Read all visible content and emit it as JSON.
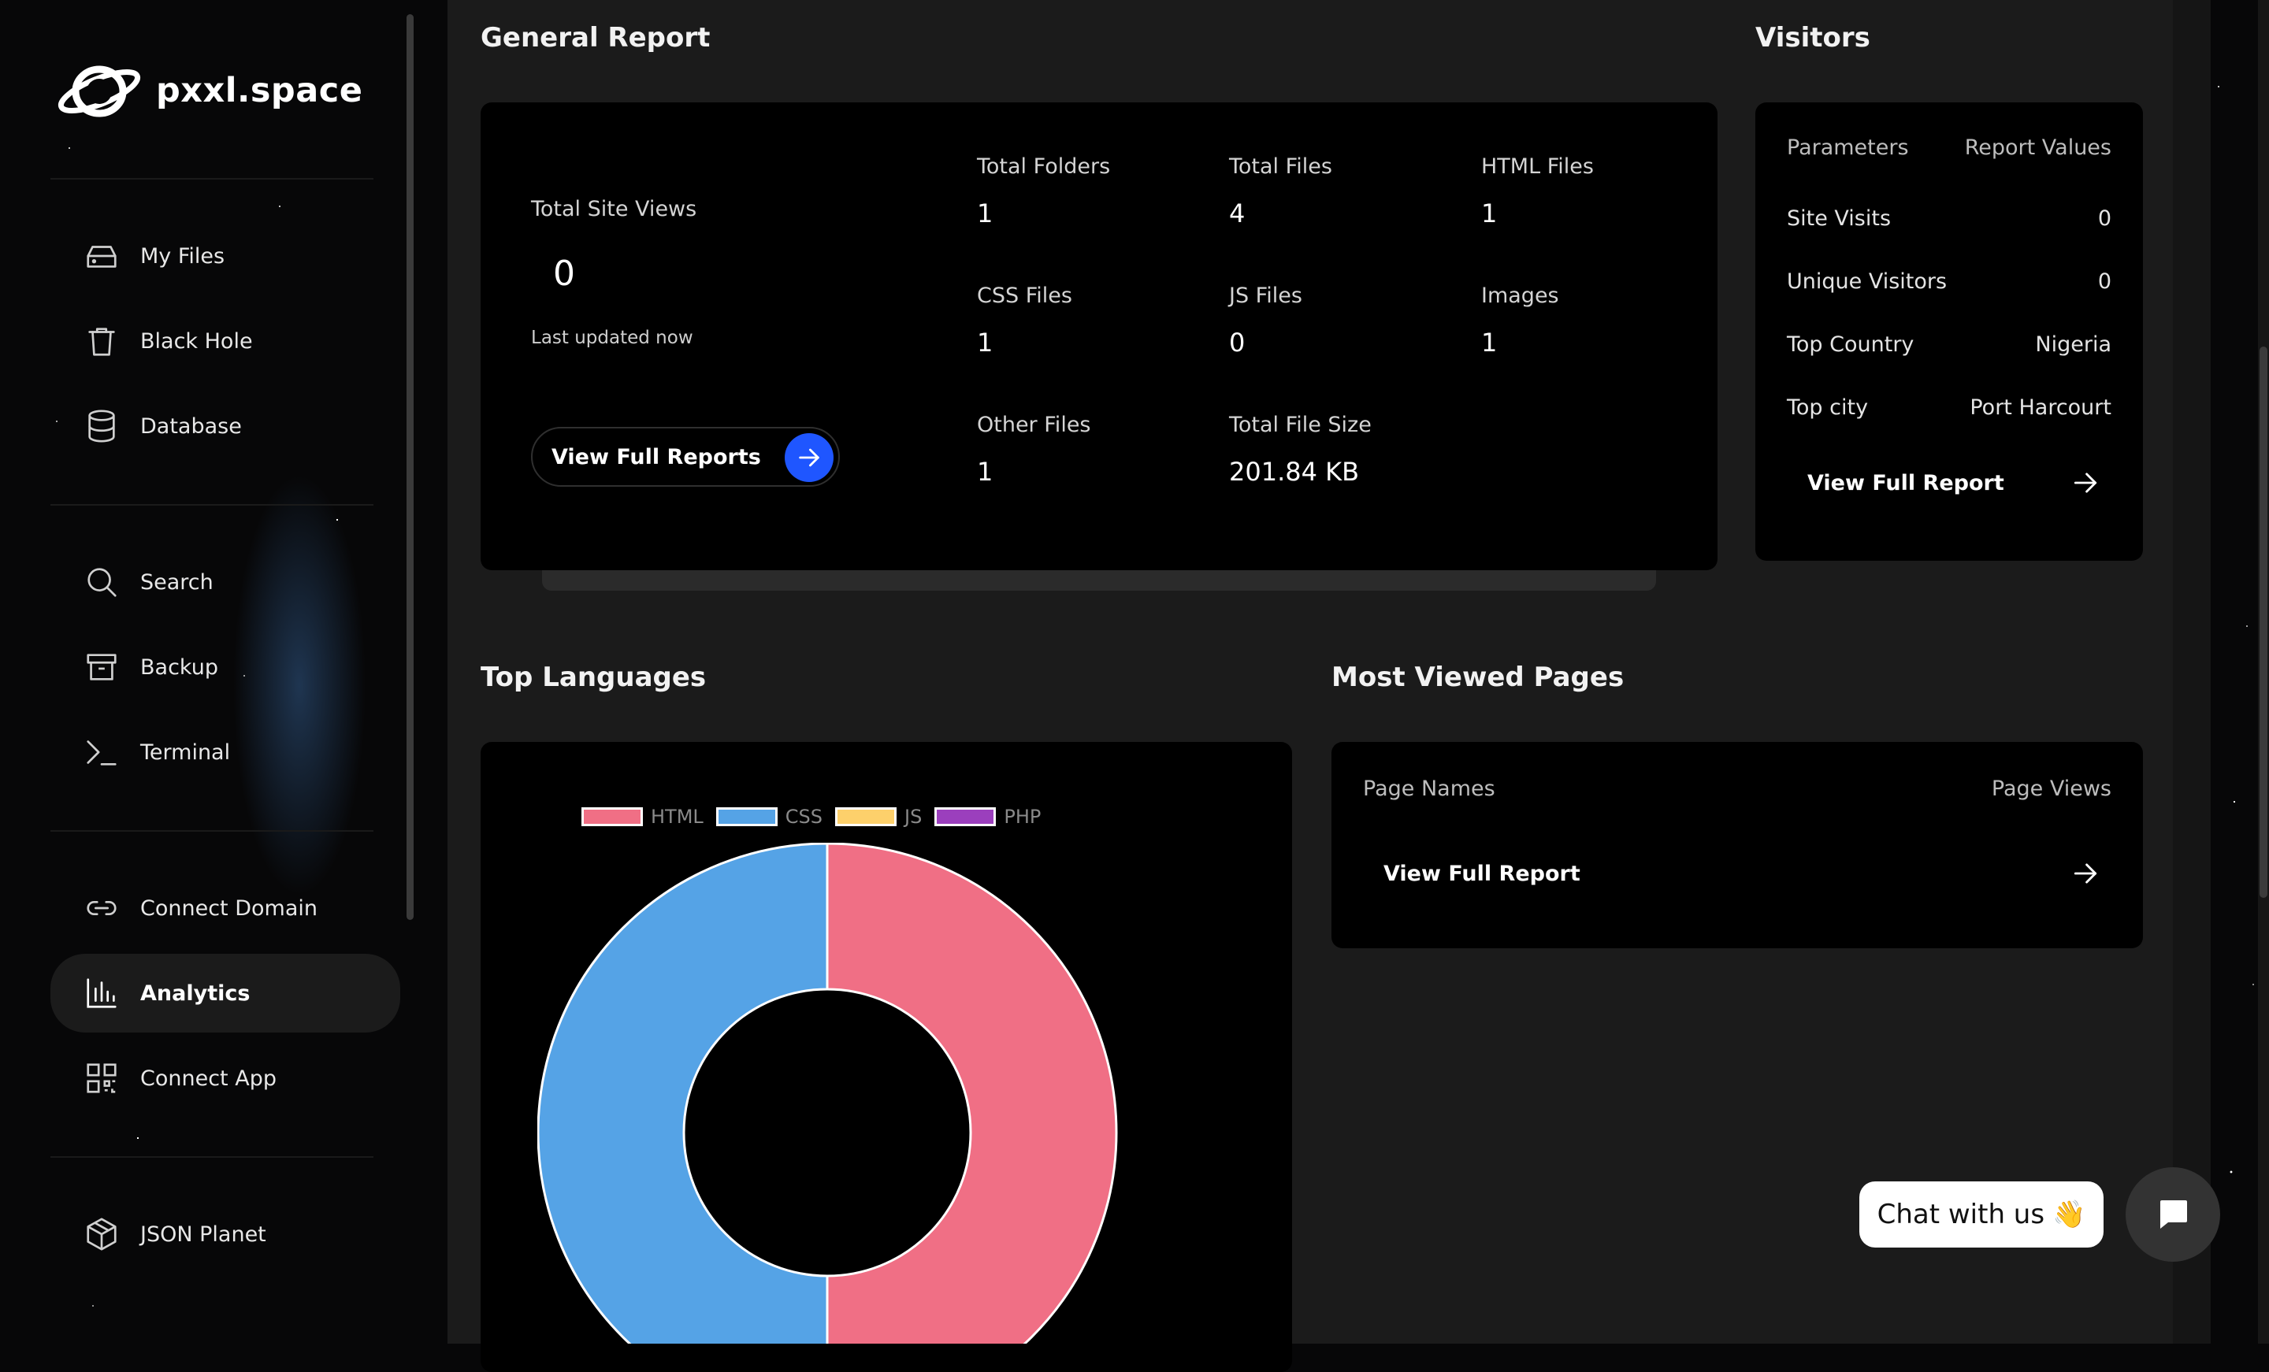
{
  "brand": {
    "name": "pxxl.space"
  },
  "sidebar": {
    "groups": [
      [
        {
          "label": "My Files",
          "icon": "drive-icon"
        },
        {
          "label": "Black Hole",
          "icon": "trash-icon"
        },
        {
          "label": "Database",
          "icon": "database-icon"
        }
      ],
      [
        {
          "label": "Search",
          "icon": "search-icon"
        },
        {
          "label": "Backup",
          "icon": "archive-icon"
        },
        {
          "label": "Terminal",
          "icon": "terminal-icon"
        }
      ],
      [
        {
          "label": "Connect Domain",
          "icon": "link-icon"
        },
        {
          "label": "Analytics",
          "icon": "bar-chart-icon",
          "active": true
        },
        {
          "label": "Connect App",
          "icon": "qr-code-icon"
        }
      ],
      [
        {
          "label": "JSON Planet",
          "icon": "cube-icon"
        }
      ]
    ]
  },
  "general_report": {
    "title": "General Report",
    "views_label": "Total Site Views",
    "views_value": "0",
    "updated": "Last updated now",
    "button_label": "View Full Reports",
    "stats": [
      {
        "label": "Total Folders",
        "value": "1"
      },
      {
        "label": "Total Files",
        "value": "4"
      },
      {
        "label": "HTML Files",
        "value": "1"
      },
      {
        "label": "CSS Files",
        "value": "1"
      },
      {
        "label": "JS Files",
        "value": "0"
      },
      {
        "label": "Images",
        "value": "1"
      },
      {
        "label": "Other Files",
        "value": "1"
      },
      {
        "label": "Total File Size",
        "value": "201.84 KB"
      }
    ]
  },
  "visitors": {
    "title": "Visitors",
    "header_left": "Parameters",
    "header_right": "Report Values",
    "rows": [
      {
        "label": "Site Visits",
        "value": "0"
      },
      {
        "label": "Unique Visitors",
        "value": "0"
      },
      {
        "label": "Top Country",
        "value": "Nigeria"
      },
      {
        "label": "Top city",
        "value": "Port Harcourt"
      }
    ],
    "link_label": "View Full Report"
  },
  "top_languages": {
    "title": "Top Languages"
  },
  "most_viewed": {
    "title": "Most Viewed Pages",
    "header_left": "Page Names",
    "header_right": "Page Views",
    "link_label": "View Full Report"
  },
  "chart_data": {
    "type": "pie",
    "variant": "doughnut",
    "categories": [
      "HTML",
      "CSS",
      "JS",
      "PHP"
    ],
    "values": [
      1,
      1,
      0,
      0
    ],
    "colors": [
      "#f06f85",
      "#55a3e6",
      "#fdd06b",
      "#9b3fbd"
    ],
    "legend": "top"
  },
  "chat": {
    "label": "Chat with us",
    "emoji": "👋"
  }
}
